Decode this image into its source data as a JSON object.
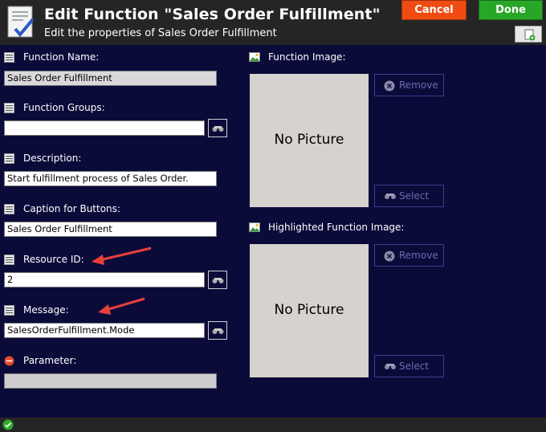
{
  "header": {
    "title": "Edit Function \"Sales Order Fulfillment\"",
    "subtitle": "Edit the properties of Sales Order Fulfillment",
    "cancel_label": "Cancel",
    "done_label": "Done"
  },
  "fields": {
    "function_name": {
      "label": "Function Name:",
      "value": "Sales Order Fulfillment"
    },
    "function_groups": {
      "label": "Function Groups:",
      "value": ""
    },
    "description": {
      "label": "Description:",
      "value": "Start fulfillment process of Sales Order."
    },
    "caption": {
      "label": "Caption for Buttons:",
      "value": "Sales Order Fulfillment"
    },
    "resource_id": {
      "label": "Resource ID:",
      "value": "2"
    },
    "message": {
      "label": "Message:",
      "value": "SalesOrderFulfillment.Mode"
    },
    "parameter": {
      "label": "Parameter:",
      "value": ""
    }
  },
  "images": {
    "function_image": {
      "label": "Function Image:",
      "placeholder": "No Picture",
      "remove_label": "Remove",
      "select_label": "Select"
    },
    "highlighted_image": {
      "label": "Highlighted Function Image:",
      "placeholder": "No Picture",
      "remove_label": "Remove",
      "select_label": "Select"
    }
  },
  "colors": {
    "background": "#0b0b3a",
    "header": "#252525",
    "cancel": "#ef4b13",
    "done": "#27a627",
    "annotation_arrow": "#e8413a"
  },
  "icons": {
    "app": "edit-document-icon",
    "field": "list-icon",
    "error": "error-icon",
    "image": "image-icon",
    "lookup": "binoculars-icon",
    "remove": "remove-icon",
    "status": "check-icon"
  }
}
